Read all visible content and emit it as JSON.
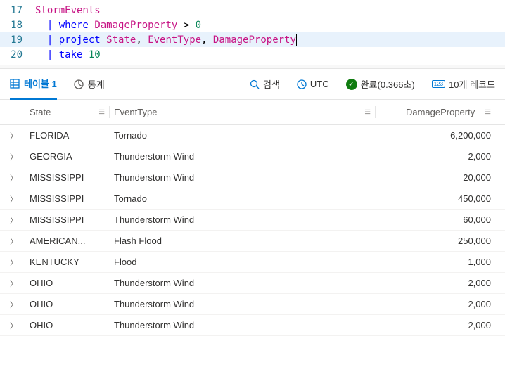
{
  "editor": {
    "lines": [
      {
        "num": "17",
        "hl": false,
        "tokens": [
          {
            "t": "StormEvents",
            "c": "id"
          }
        ]
      },
      {
        "num": "18",
        "hl": false,
        "tokens": [
          {
            "t": "| ",
            "c": "pipe"
          },
          {
            "t": "where",
            "c": "kw"
          },
          {
            "t": " ",
            "c": "op"
          },
          {
            "t": "DamageProperty",
            "c": "id"
          },
          {
            "t": " > ",
            "c": "op"
          },
          {
            "t": "0",
            "c": "num"
          }
        ]
      },
      {
        "num": "19",
        "hl": true,
        "tokens": [
          {
            "t": "| ",
            "c": "pipe"
          },
          {
            "t": "project",
            "c": "kw"
          },
          {
            "t": " ",
            "c": "op"
          },
          {
            "t": "State",
            "c": "id"
          },
          {
            "t": ", ",
            "c": "op"
          },
          {
            "t": "EventType",
            "c": "id"
          },
          {
            "t": ", ",
            "c": "op"
          },
          {
            "t": "DamageProperty",
            "c": "id"
          }
        ],
        "cursor": true
      },
      {
        "num": "20",
        "hl": false,
        "tokens": [
          {
            "t": "| ",
            "c": "pipe"
          },
          {
            "t": "take",
            "c": "kw"
          },
          {
            "t": " ",
            "c": "op"
          },
          {
            "t": "10",
            "c": "num"
          }
        ]
      }
    ]
  },
  "tabs": {
    "table_label": "테이블 1",
    "stats_label": "통계",
    "search_label": "검색",
    "utc_label": "UTC",
    "status_label": "완료(0.366초)",
    "records_label": "10개 레코드"
  },
  "columns": {
    "state": "State",
    "event": "EventType",
    "damage": "DamageProperty"
  },
  "rows": [
    {
      "state": "FLORIDA",
      "event": "Tornado",
      "damage": "6,200,000"
    },
    {
      "state": "GEORGIA",
      "event": "Thunderstorm Wind",
      "damage": "2,000"
    },
    {
      "state": "MISSISSIPPI",
      "event": "Thunderstorm Wind",
      "damage": "20,000"
    },
    {
      "state": "MISSISSIPPI",
      "event": "Tornado",
      "damage": "450,000"
    },
    {
      "state": "MISSISSIPPI",
      "event": "Thunderstorm Wind",
      "damage": "60,000"
    },
    {
      "state": "AMERICAN...",
      "event": "Flash Flood",
      "damage": "250,000"
    },
    {
      "state": "KENTUCKY",
      "event": "Flood",
      "damage": "1,000"
    },
    {
      "state": "OHIO",
      "event": "Thunderstorm Wind",
      "damage": "2,000"
    },
    {
      "state": "OHIO",
      "event": "Thunderstorm Wind",
      "damage": "2,000"
    },
    {
      "state": "OHIO",
      "event": "Thunderstorm Wind",
      "damage": "2,000"
    }
  ]
}
